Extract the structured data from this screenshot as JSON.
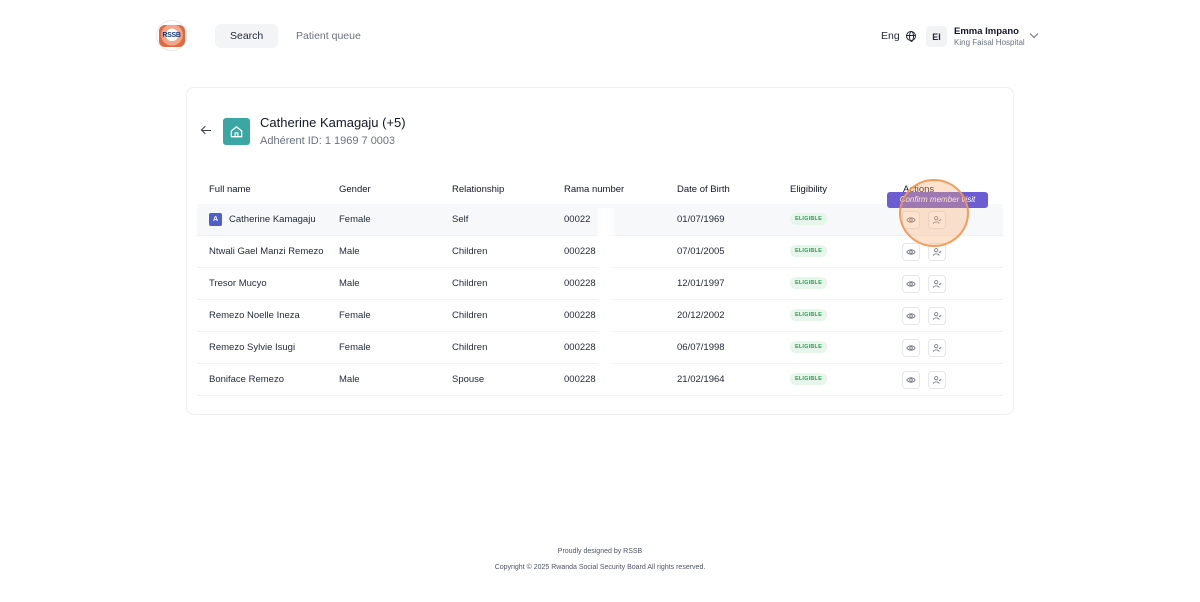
{
  "header": {
    "logo_text": "RSSB",
    "tabs": [
      {
        "label": "Search"
      },
      {
        "label": "Patient queue"
      }
    ],
    "language": "Eng",
    "user": {
      "initials": "EI",
      "name": "Emma Impano",
      "hospital": "King Faisal Hospital"
    }
  },
  "family": {
    "title": "Catherine Kamagaju (+5)",
    "adherent_id": "Adhérent ID: 1 1969 7 0003"
  },
  "table": {
    "headers": [
      "Full name",
      "Gender",
      "Relationship",
      "Rama number",
      "Date of Birth",
      "Eligibility",
      "Actions"
    ],
    "rows": [
      {
        "name": "Catherine Kamagaju",
        "gender": "Female",
        "relationship": "Self",
        "rama": "00022",
        "dob": "01/07/1969",
        "eligibility": "ELIGIBLE"
      },
      {
        "name": "Ntwali Gael Manzi Remezo",
        "gender": "Male",
        "relationship": "Children",
        "rama": "000228",
        "dob": "07/01/2005",
        "eligibility": "ELIGIBLE"
      },
      {
        "name": "Tresor Mucyo",
        "gender": "Male",
        "relationship": "Children",
        "rama": "000228",
        "dob": "12/01/1997",
        "eligibility": "ELIGIBLE"
      },
      {
        "name": "Remezo Noelle Ineza",
        "gender": "Female",
        "relationship": "Children",
        "rama": "000228",
        "dob": "20/12/2002",
        "eligibility": "ELIGIBLE"
      },
      {
        "name": "Remezo Sylvie Isugi",
        "gender": "Female",
        "relationship": "Children",
        "rama": "000228",
        "dob": "06/07/1998",
        "eligibility": "ELIGIBLE"
      },
      {
        "name": "Boniface Remezo",
        "gender": "Male",
        "relationship": "Spouse",
        "rama": "000228",
        "dob": "21/02/1964",
        "eligibility": "ELIGIBLE"
      }
    ],
    "self_badge": "A"
  },
  "tooltip": "Confirm member visit",
  "footer": {
    "line1": "Proudly designed by RSSB",
    "line2": "Copyright © 2025 Rwanda Social Security Board All rights reserved."
  },
  "colors": {
    "accent": "#3aa7a4",
    "tooltip": "#6d5dd3",
    "eligible_bg": "#e6f6ea",
    "eligible_text": "#2f9e55"
  }
}
